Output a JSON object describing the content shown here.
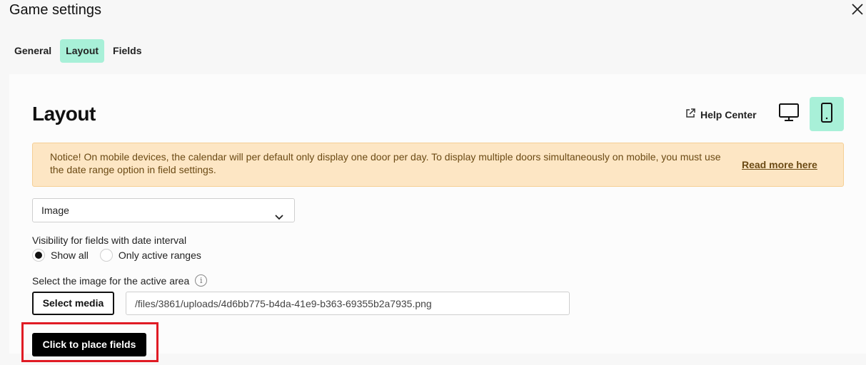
{
  "dialog": {
    "title": "Game settings",
    "close_icon": "close-icon"
  },
  "tabs": [
    {
      "label": "General",
      "active": false
    },
    {
      "label": "Layout",
      "active": true
    },
    {
      "label": "Fields",
      "active": false
    }
  ],
  "layout": {
    "heading": "Layout",
    "help_center_label": "Help Center",
    "help_icon": "external-link-icon",
    "device_buttons": [
      {
        "name": "desktop",
        "icon": "monitor-icon",
        "active": false
      },
      {
        "name": "mobile",
        "icon": "smartphone-icon",
        "active": true
      }
    ],
    "notice": {
      "text": "Notice! On mobile devices, the calendar will per default only display one door per day. To display multiple doors simultaneously on mobile, you must use the date range option in field settings.",
      "link_label": "Read more here"
    },
    "type_select": {
      "value": "Image"
    },
    "visibility": {
      "label": "Visibility for fields with date interval",
      "options": [
        {
          "label": "Show all",
          "selected": true
        },
        {
          "label": "Only active ranges",
          "selected": false
        }
      ]
    },
    "image": {
      "label": "Select the image for the active area",
      "select_media_label": "Select media",
      "path_value": "/files/3861/uploads/4d6bb775-b4da-41e9-b363-69355b2a7935.png"
    },
    "place_fields_label": "Click to place fields"
  },
  "colors": {
    "accent": "#a8f0d8",
    "notice_bg": "#fde6c4",
    "highlight": "#e01b24"
  }
}
